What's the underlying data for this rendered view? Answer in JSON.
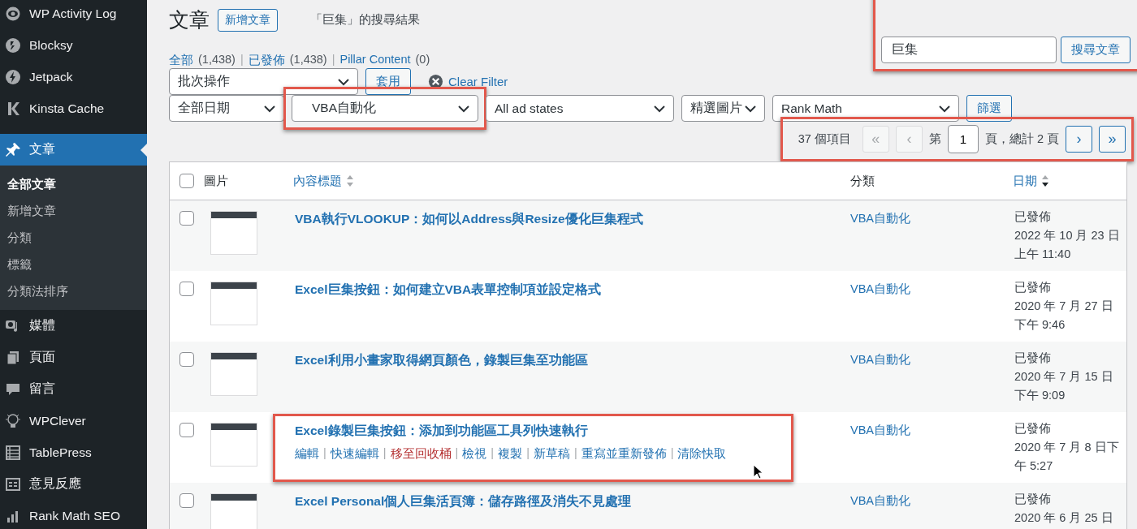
{
  "sidebar": {
    "items": [
      {
        "label": "WP Activity Log",
        "selected": false
      },
      {
        "label": "Blocksy",
        "selected": false
      },
      {
        "label": "Jetpack",
        "selected": false
      },
      {
        "label": "Kinsta Cache",
        "selected": false
      },
      {
        "label": "文章",
        "selected": true,
        "children": [
          {
            "label": "全部文章",
            "selected": true
          },
          {
            "label": "新增文章",
            "selected": false
          },
          {
            "label": "分類",
            "selected": false
          },
          {
            "label": "標籤",
            "selected": false
          },
          {
            "label": "分類法排序",
            "selected": false
          }
        ]
      },
      {
        "label": "媒體",
        "selected": false
      },
      {
        "label": "頁面",
        "selected": false
      },
      {
        "label": "留言",
        "selected": false
      },
      {
        "label": "WPClever",
        "selected": false
      },
      {
        "label": "TablePress",
        "selected": false
      },
      {
        "label": "意見反應",
        "selected": false
      },
      {
        "label": "Rank Math SEO",
        "selected": false
      }
    ]
  },
  "header": {
    "title": "文章",
    "add_button": "新增文章",
    "subtitle": "「巨集」的搜尋結果"
  },
  "search": {
    "value": "巨集",
    "button": "搜尋文章",
    "highlighted": true
  },
  "views_separator": "|",
  "views": [
    {
      "label": "全部",
      "count": "(1,438)",
      "selected": false
    },
    {
      "label": "已發佈",
      "count": "(1,438)",
      "selected": false
    },
    {
      "label": "Pillar Content",
      "count": "(0)",
      "selected": false
    }
  ],
  "bulk": {
    "select": "批次操作",
    "apply": "套用",
    "clear_filter": "Clear Filter"
  },
  "filters": {
    "selects": [
      {
        "value": "全部日期",
        "highlighted": false
      },
      {
        "value": "VBA自動化",
        "highlighted": true
      },
      {
        "value": "All ad states",
        "highlighted": false
      },
      {
        "value": "精選圖片",
        "highlighted": false
      },
      {
        "value": "Rank Math",
        "highlighted": false
      }
    ],
    "button": "篩選"
  },
  "pagination": {
    "count": "37 個項目",
    "highlighted": true,
    "first": {
      "label": "«",
      "disabled": true
    },
    "prev": {
      "label": "‹",
      "disabled": true
    },
    "page_prefix": "第",
    "page": "1",
    "page_suffix": "頁，總計 2 頁",
    "next": {
      "label": "›",
      "disabled": false
    },
    "last": {
      "label": "»",
      "disabled": false
    }
  },
  "table": {
    "header_checked": false,
    "columns": [
      {
        "label": "圖片",
        "kind": "plain"
      },
      {
        "label": "內容標題",
        "kind": "sortable",
        "sorted": false
      },
      {
        "label": "分類",
        "kind": "plain"
      },
      {
        "label": "日期",
        "kind": "sortable",
        "sorted": true
      }
    ],
    "rows": [
      {
        "checked": false,
        "highlighted": false,
        "title": "VBA執行VLOOKUP：如何以Address與Resize優化巨集程式",
        "category": "VBA自動化",
        "status": "已發佈",
        "date_lines": [
          "2022 年 10 月 23 日",
          "上午 11:40"
        ]
      },
      {
        "checked": false,
        "highlighted": false,
        "title": "Excel巨集按鈕：如何建立VBA表單控制項並設定格式",
        "category": "VBA自動化",
        "status": "已發佈",
        "date_lines": [
          "2020 年 7 月 27 日",
          "下午 9:46"
        ]
      },
      {
        "checked": false,
        "highlighted": false,
        "title": "Excel利用小畫家取得網頁顏色，錄製巨集至功能區",
        "category": "VBA自動化",
        "status": "已發佈",
        "date_lines": [
          "2020 年 7 月 15 日",
          "下午 9:09"
        ]
      },
      {
        "checked": false,
        "highlighted": true,
        "title": "Excel錄製巨集按鈕：添加到功能區工具列快速執行",
        "category": "VBA自動化",
        "status": "已發佈",
        "date_lines": [
          "2020 年 7 月 8 日下",
          "午 5:27"
        ],
        "action_separator": "|",
        "actions": [
          {
            "label": "編輯",
            "kind": "link"
          },
          {
            "label": "快速編輯",
            "kind": "link"
          },
          {
            "label": "移至回收桶",
            "kind": "delete"
          },
          {
            "label": "檢視",
            "kind": "link"
          },
          {
            "label": "複製",
            "kind": "link"
          },
          {
            "label": "新草稿",
            "kind": "link"
          },
          {
            "label": "重寫並重新發佈",
            "kind": "link"
          },
          {
            "label": "清除快取",
            "kind": "link"
          }
        ]
      },
      {
        "checked": false,
        "highlighted": false,
        "title": "Excel Personal個人巨集活頁簿：儲存路徑及消失不見處理",
        "category": "VBA自動化",
        "status": "已發佈",
        "date_lines": [
          "2020 年 6 月 25 日"
        ]
      }
    ]
  }
}
